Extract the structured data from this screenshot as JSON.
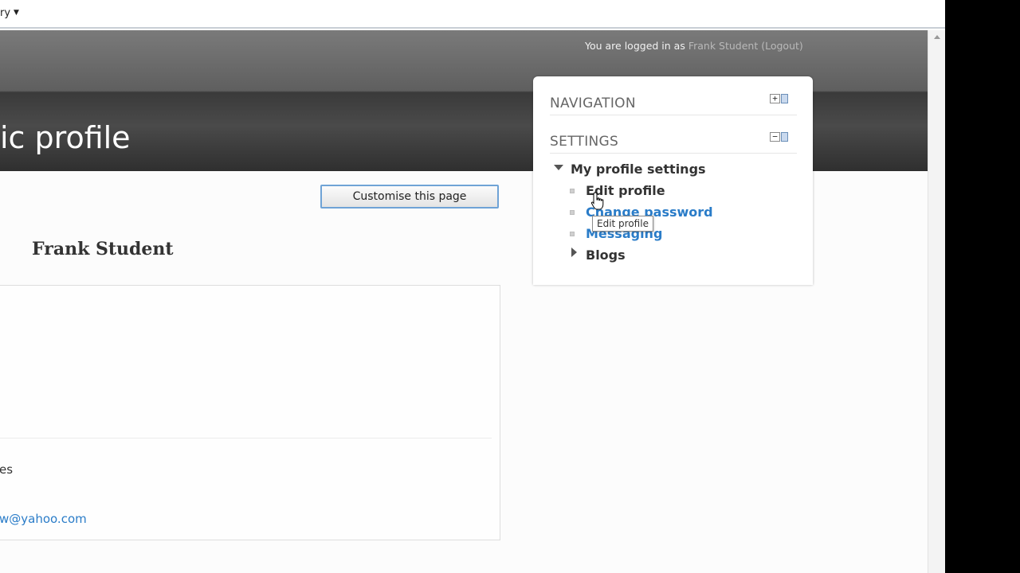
{
  "browser": {
    "toolbar_menu_label": "ry"
  },
  "header": {
    "login_prefix": "You are logged in as ",
    "user_link": "Frank Student",
    "logout_open": " (",
    "logout_link": "Logout",
    "logout_close": ")",
    "page_title": "ic profile"
  },
  "content": {
    "customise_button": "Customise this page",
    "user_name": "Frank Student",
    "profile_field_tail": "es",
    "profile_email": "w@yahoo.com"
  },
  "blocks": {
    "navigation": {
      "heading": "NAVIGATION",
      "toggle_symbol": "+"
    },
    "settings": {
      "heading": "SETTINGS",
      "toggle_symbol": "−",
      "group_label": "My profile settings",
      "items": [
        {
          "label": "Edit profile"
        },
        {
          "label": "Change password"
        },
        {
          "label": "Messaging"
        }
      ],
      "blogs_label": "Blogs"
    }
  },
  "tooltip": {
    "text": "Edit profile"
  },
  "colors": {
    "link": "#2a7cc8",
    "header_dark": "#2f2f2f",
    "button_border": "#6fa3d6"
  }
}
